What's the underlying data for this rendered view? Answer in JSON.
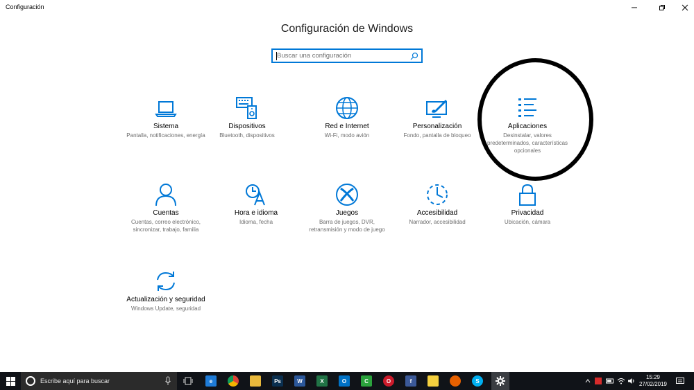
{
  "window": {
    "title": "Configuración"
  },
  "page": {
    "heading": "Configuración de Windows"
  },
  "search": {
    "placeholder": "Buscar una configuración"
  },
  "tiles": [
    {
      "id": "sistema",
      "name": "Sistema",
      "desc": "Pantalla, notificaciones, energía",
      "icon": "laptop-icon"
    },
    {
      "id": "dispositivos",
      "name": "Dispositivos",
      "desc": "Bluetooth, dispositivos",
      "icon": "keyboard-speaker-icon"
    },
    {
      "id": "red",
      "name": "Red e Internet",
      "desc": "Wi-Fi, modo avión",
      "icon": "globe-icon"
    },
    {
      "id": "personalizacion",
      "name": "Personalización",
      "desc": "Fondo, pantalla de bloqueo",
      "icon": "paint-screen-icon"
    },
    {
      "id": "aplicaciones",
      "name": "Aplicaciones",
      "desc": "Desinstalar, valores predeterminados, características opcionales",
      "icon": "app-list-icon"
    },
    {
      "id": "cuentas",
      "name": "Cuentas",
      "desc": "Cuentas, correo electrónico, sincronizar, trabajo, familia",
      "icon": "person-icon"
    },
    {
      "id": "hora",
      "name": "Hora e idioma",
      "desc": "Idioma, fecha",
      "icon": "time-language-icon"
    },
    {
      "id": "juegos",
      "name": "Juegos",
      "desc": "Barra de juegos, DVR, retransmisión y modo de juego",
      "icon": "xbox-icon"
    },
    {
      "id": "accesibilidad",
      "name": "Accesibilidad",
      "desc": "Narrador, accesibilidad",
      "icon": "ease-of-access-icon"
    },
    {
      "id": "privacidad",
      "name": "Privacidad",
      "desc": "Ubicación, cámara",
      "icon": "lock-icon"
    },
    {
      "id": "actualizacion",
      "name": "Actualización y seguridad",
      "desc": "Windows Update, seguridad",
      "icon": "sync-arrows-icon"
    }
  ],
  "taskbar": {
    "search_text": "Escribe aquí para buscar",
    "time": "15:29",
    "date": "27/02/2019",
    "apps": [
      {
        "name": "edge",
        "label": "e",
        "color": "#1e7bd7"
      },
      {
        "name": "chrome",
        "label": "",
        "color": "#e0b400"
      },
      {
        "name": "file-explorer",
        "label": "",
        "color": "#e8b83c"
      },
      {
        "name": "photoshop",
        "label": "Ps",
        "color": "#0a2f4f"
      },
      {
        "name": "word",
        "label": "W",
        "color": "#2b579a"
      },
      {
        "name": "excel",
        "label": "X",
        "color": "#217346"
      },
      {
        "name": "outlook",
        "label": "O",
        "color": "#0072c6"
      },
      {
        "name": "camtasia",
        "label": "C",
        "color": "#2ba33d"
      },
      {
        "name": "opera",
        "label": "O",
        "color": "#cc1b2b"
      },
      {
        "name": "facebook",
        "label": "f",
        "color": "#3b5998"
      },
      {
        "name": "sticky-notes",
        "label": "",
        "color": "#f4d03f"
      },
      {
        "name": "firefox",
        "label": "",
        "color": "#e66000"
      },
      {
        "name": "skype",
        "label": "S",
        "color": "#00aff0"
      },
      {
        "name": "settings",
        "label": "",
        "color": "#3a3d42"
      }
    ],
    "accent": "#0078d7"
  }
}
